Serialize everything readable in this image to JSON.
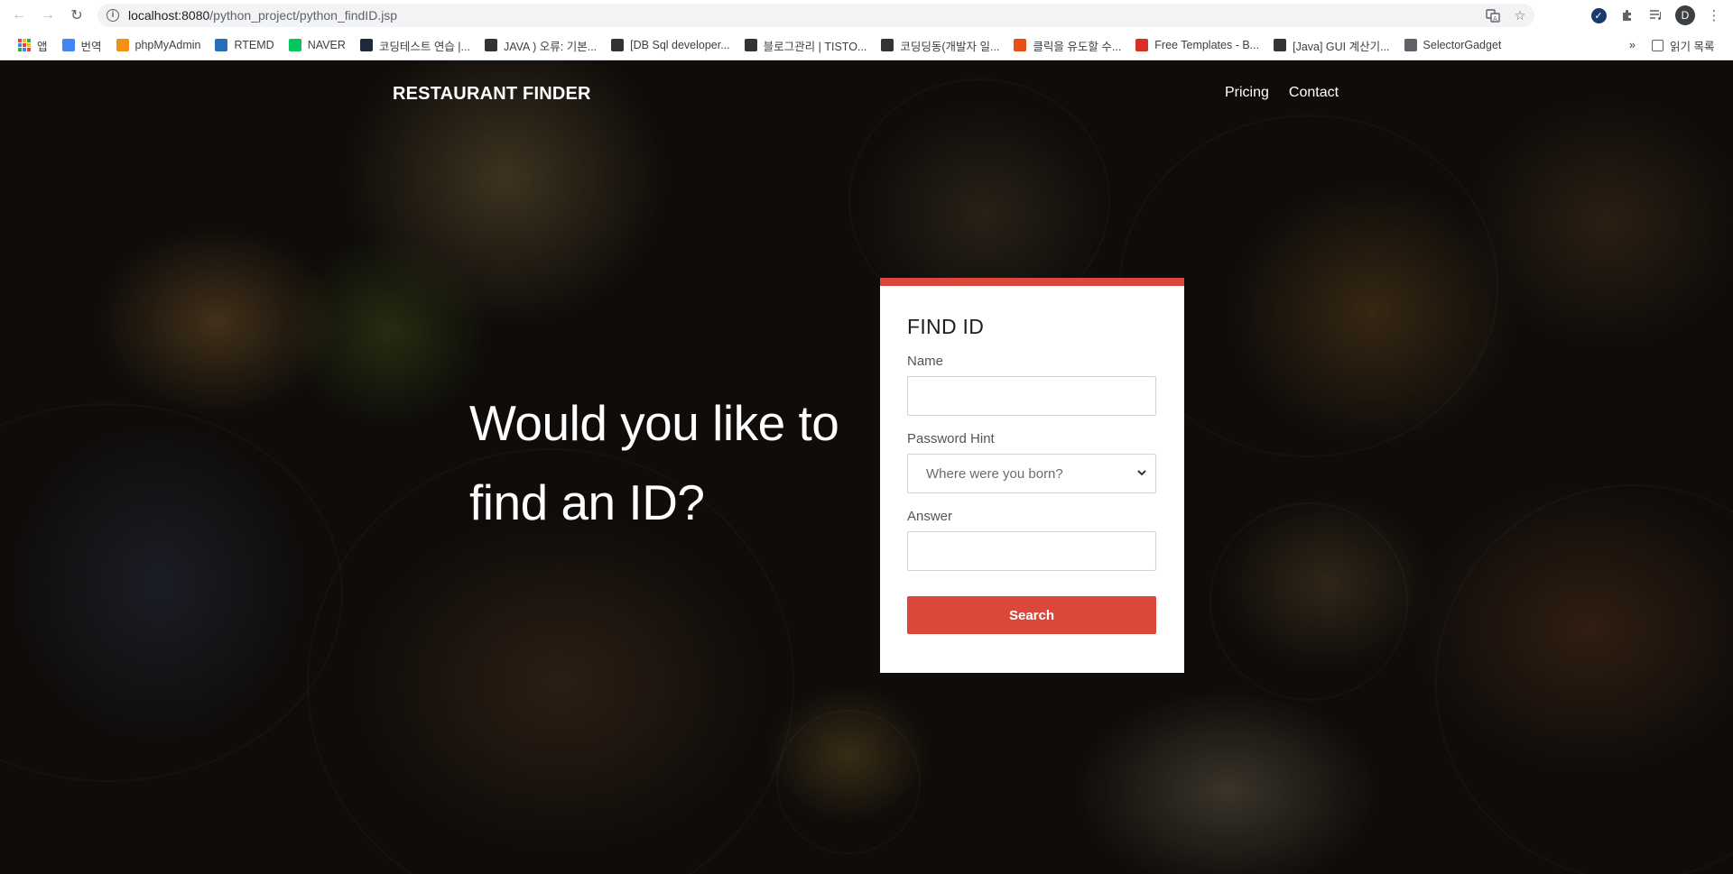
{
  "browser": {
    "url_host": "localhost:8080",
    "url_path": "/python_project/python_findID.jsp",
    "profile_initial": "D"
  },
  "bookmarks": [
    {
      "label": "앱",
      "icon": "apps-grid-icon",
      "color": ""
    },
    {
      "label": "번역",
      "icon": "google-translate-icon",
      "color": "#4285f4"
    },
    {
      "label": "phpMyAdmin",
      "icon": "phpmyadmin-icon",
      "color": "#f29111"
    },
    {
      "label": "RTEMD",
      "icon": "dsm-icon",
      "color": "#2a6ebb"
    },
    {
      "label": "NAVER",
      "icon": "naver-icon",
      "color": "#03c75a"
    },
    {
      "label": "코딩테스트 연습 |...",
      "icon": "programmers-icon",
      "color": "#1e2a3a"
    },
    {
      "label": "JAVA ) 오류: 기본...",
      "icon": "tistory-bar-icon",
      "color": "#333333"
    },
    {
      "label": "[DB Sql developer...",
      "icon": "tistory-dots-icon",
      "color": "#333333"
    },
    {
      "label": "블로그관리 | TISTO...",
      "icon": "tistory-dots-icon",
      "color": "#333333"
    },
    {
      "label": "코딩딩동(개발자 일...",
      "icon": "tistory-dots-icon",
      "color": "#333333"
    },
    {
      "label": "클릭을 유도할 수...",
      "icon": "bookmark-orange-icon",
      "color": "#e8501a"
    },
    {
      "label": "Free Templates - B...",
      "icon": "templates-target-icon",
      "color": "#d93025"
    },
    {
      "label": "[Java] GUI 계산기...",
      "icon": "tistory-dots-icon",
      "color": "#333333"
    },
    {
      "label": "SelectorGadget",
      "icon": "selectorgadget-icon",
      "color": "#5f6368"
    }
  ],
  "reading_list_label": "읽기 목록",
  "site": {
    "brand": "RESTAURANT FINDER",
    "nav": [
      "Pricing",
      "Contact"
    ],
    "headline": "Would you like to find an ID?"
  },
  "form": {
    "title": "FIND ID",
    "name_label": "Name",
    "name_value": "",
    "hint_label": "Password Hint",
    "hint_selected": "Where were you born?",
    "answer_label": "Answer",
    "answer_value": "",
    "submit_label": "Search"
  },
  "colors": {
    "accent": "#d9483b",
    "card_bg": "#ffffff",
    "overlay": "rgba(0,0,0,0.42)"
  }
}
